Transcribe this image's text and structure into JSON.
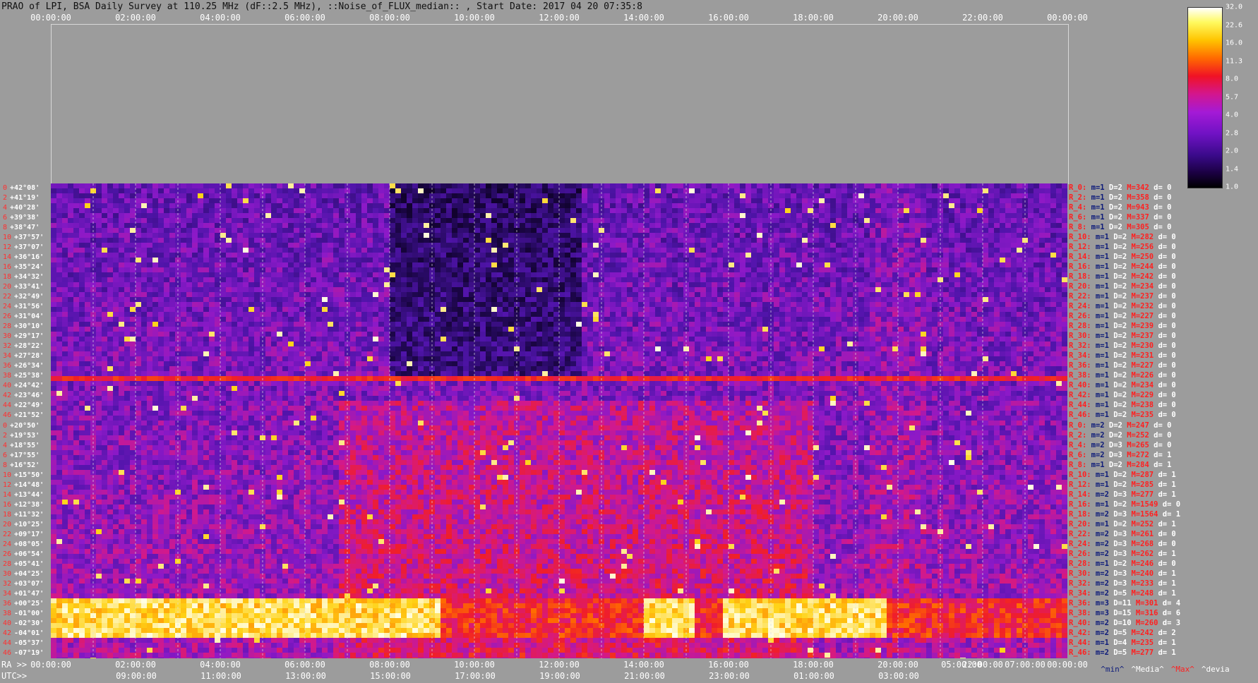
{
  "title": "PRAO of LPI, BSA Daily Survey at 110.25 MHz (dF::2.5 MHz), ::Noise_of_FLUX_median:: , Start Date: 2017 04 20 07:35:8",
  "chart_data": {
    "type": "heatmap",
    "x_ticks_top": [
      "00:00:00",
      "02:00:00",
      "04:00:00",
      "06:00:00",
      "08:00:00",
      "10:00:00",
      "12:00:00",
      "14:00:00",
      "16:00:00",
      "18:00:00",
      "20:00:00",
      "22:00:00",
      "00:00:00"
    ],
    "x_ticks_ra": [
      "00:00:00",
      "02:00:00",
      "04:00:00",
      "06:00:00",
      "08:00:00",
      "10:00:00",
      "12:00:00",
      "14:00:00",
      "16:00:00",
      "18:00:00",
      "20:00:00",
      "05:00:00",
      "22:00:00",
      "07:00:00",
      "00:00:00"
    ],
    "x_ticks_utc": [
      "09:00:00",
      "11:00:00",
      "13:00:00",
      "15:00:00",
      "17:00:00",
      "19:00:00",
      "21:00:00",
      "23:00:00",
      "01:00:00",
      "03:00:00"
    ],
    "ra_prefix": "RA >>",
    "utc_prefix": "UTC>>",
    "colorbar_ticks": [
      "32.0",
      "22.6",
      "16.0",
      "11.3",
      "8.0",
      "5.7",
      "4.0",
      "2.8",
      "2.0",
      "1.4",
      "1.0"
    ],
    "declinations": [
      "+42°08'",
      "+41°19'",
      "+40°28'",
      "+39°38'",
      "+38°47'",
      "+37°57'",
      "+37°07'",
      "+36°16'",
      "+35°24'",
      "+34°32'",
      "+33°41'",
      "+32°49'",
      "+31°56'",
      "+31°04'",
      "+30°10'",
      "+29°17'",
      "+28°22'",
      "+27°28'",
      "+26°34'",
      "+25°38'",
      "+24°42'",
      "+23°46'",
      "+22°49'",
      "+21°52'",
      "+20°50'",
      "+19°53'",
      "+18°55'",
      "+17°55'",
      "+16°52'",
      "+15°50'",
      "+14°48'",
      "+13°44'",
      "+12°38'",
      "+11°32'",
      "+10°25'",
      "+09°17'",
      "+08°05'",
      "+06°54'",
      "+05°41'",
      "+04°25'",
      "+03°07'",
      "+01°47'",
      "+00°25'",
      "-01°00'",
      "-02°30'",
      "-04°01'",
      "-05°37'",
      "-07°19'"
    ],
    "dec_indices": [
      "0",
      "2",
      "4",
      "6",
      "8",
      "10",
      "12",
      "14",
      "16",
      "18",
      "20",
      "22",
      "24",
      "26",
      "28",
      "30",
      "32",
      "34",
      "36",
      "38",
      "40",
      "42",
      "44",
      "46",
      "0",
      "2",
      "4",
      "6",
      "8",
      "10",
      "12",
      "14",
      "16",
      "18",
      "20",
      "22",
      "24",
      "26",
      "28",
      "30",
      "32",
      "34",
      "36",
      "38",
      "40",
      "42",
      "44",
      "46"
    ],
    "row_stats": [
      {
        "r": "R_0:",
        "m": "m=1",
        "D": "D=2",
        "M": "M=342",
        "d": "d= 0"
      },
      {
        "r": "R_2:",
        "m": "m=1",
        "D": "D=2",
        "M": "M=358",
        "d": "d= 0"
      },
      {
        "r": "R_4:",
        "m": "m=1",
        "D": "D=2",
        "M": "M=943",
        "d": "d= 0"
      },
      {
        "r": "R_6:",
        "m": "m=1",
        "D": "D=2",
        "M": "M=337",
        "d": "d= 0"
      },
      {
        "r": "R_8:",
        "m": "m=1",
        "D": "D=2",
        "M": "M=305",
        "d": "d= 0"
      },
      {
        "r": "R_10:",
        "m": "m=1",
        "D": "D=2",
        "M": "M=282",
        "d": "d= 0"
      },
      {
        "r": "R_12:",
        "m": "m=1",
        "D": "D=2",
        "M": "M=256",
        "d": "d= 0"
      },
      {
        "r": "R_14:",
        "m": "m=1",
        "D": "D=2",
        "M": "M=250",
        "d": "d= 0"
      },
      {
        "r": "R_16:",
        "m": "m=1",
        "D": "D=2",
        "M": "M=244",
        "d": "d= 0"
      },
      {
        "r": "R_18:",
        "m": "m=1",
        "D": "D=2",
        "M": "M=242",
        "d": "d= 0"
      },
      {
        "r": "R_20:",
        "m": "m=1",
        "D": "D=2",
        "M": "M=234",
        "d": "d= 0"
      },
      {
        "r": "R_22:",
        "m": "m=1",
        "D": "D=2",
        "M": "M=237",
        "d": "d= 0"
      },
      {
        "r": "R_24:",
        "m": "m=1",
        "D": "D=2",
        "M": "M=232",
        "d": "d= 0"
      },
      {
        "r": "R_26:",
        "m": "m=1",
        "D": "D=2",
        "M": "M=227",
        "d": "d= 0"
      },
      {
        "r": "R_28:",
        "m": "m=1",
        "D": "D=2",
        "M": "M=239",
        "d": "d= 0"
      },
      {
        "r": "R_30:",
        "m": "m=1",
        "D": "D=2",
        "M": "M=237",
        "d": "d= 0"
      },
      {
        "r": "R_32:",
        "m": "m=1",
        "D": "D=2",
        "M": "M=230",
        "d": "d= 0"
      },
      {
        "r": "R_34:",
        "m": "m=1",
        "D": "D=2",
        "M": "M=231",
        "d": "d= 0"
      },
      {
        "r": "R_36:",
        "m": "m=1",
        "D": "D=2",
        "M": "M=227",
        "d": "d= 0"
      },
      {
        "r": "R_38:",
        "m": "m=1",
        "D": "D=2",
        "M": "M=226",
        "d": "d= 0"
      },
      {
        "r": "R_40:",
        "m": "m=1",
        "D": "D=2",
        "M": "M=234",
        "d": "d= 0"
      },
      {
        "r": "R_42:",
        "m": "m=1",
        "D": "D=2",
        "M": "M=229",
        "d": "d= 0"
      },
      {
        "r": "R_44:",
        "m": "m=1",
        "D": "D=2",
        "M": "M=238",
        "d": "d= 0"
      },
      {
        "r": "R_46:",
        "m": "m=1",
        "D": "D=2",
        "M": "M=235",
        "d": "d= 0"
      },
      {
        "r": "R_0:",
        "m": "m=2",
        "D": "D=2",
        "M": "M=247",
        "d": "d= 0"
      },
      {
        "r": "R_2:",
        "m": "m=2",
        "D": "D=2",
        "M": "M=252",
        "d": "d= 0"
      },
      {
        "r": "R_4:",
        "m": "m=2",
        "D": "D=3",
        "M": "M=265",
        "d": "d= 0"
      },
      {
        "r": "R_6:",
        "m": "m=2",
        "D": "D=3",
        "M": "M=272",
        "d": "d= 1"
      },
      {
        "r": "R_8:",
        "m": "m=1",
        "D": "D=2",
        "M": "M=284",
        "d": "d= 1"
      },
      {
        "r": "R_10:",
        "m": "m=1",
        "D": "D=2",
        "M": "M=287",
        "d": "d= 1"
      },
      {
        "r": "R_12:",
        "m": "m=1",
        "D": "D=2",
        "M": "M=285",
        "d": "d= 1"
      },
      {
        "r": "R_14:",
        "m": "m=2",
        "D": "D=3",
        "M": "M=277",
        "d": "d= 1"
      },
      {
        "r": "R_16:",
        "m": "m=1",
        "D": "D=2",
        "M": "M=1549",
        "d": "d= 0"
      },
      {
        "r": "R_18:",
        "m": "m=2",
        "D": "D=3",
        "M": "M=1564",
        "d": "d= 1"
      },
      {
        "r": "R_20:",
        "m": "m=1",
        "D": "D=2",
        "M": "M=252",
        "d": "d= 1"
      },
      {
        "r": "R_22:",
        "m": "m=2",
        "D": "D=3",
        "M": "M=261",
        "d": "d= 0"
      },
      {
        "r": "R_24:",
        "m": "m=2",
        "D": "D=3",
        "M": "M=268",
        "d": "d= 0"
      },
      {
        "r": "R_26:",
        "m": "m=2",
        "D": "D=3",
        "M": "M=262",
        "d": "d= 1"
      },
      {
        "r": "R_28:",
        "m": "m=1",
        "D": "D=2",
        "M": "M=246",
        "d": "d= 0"
      },
      {
        "r": "R_30:",
        "m": "m=2",
        "D": "D=3",
        "M": "M=240",
        "d": "d= 1"
      },
      {
        "r": "R_32:",
        "m": "m=2",
        "D": "D=3",
        "M": "M=233",
        "d": "d= 1"
      },
      {
        "r": "R_34:",
        "m": "m=2",
        "D": "D=5",
        "M": "M=248",
        "d": "d= 1"
      },
      {
        "r": "R_36:",
        "m": "m=3",
        "D": "D=11",
        "M": "M=301",
        "d": "d= 4"
      },
      {
        "r": "R_38:",
        "m": "m=3",
        "D": "D=15",
        "M": "M=316",
        "d": "d= 6"
      },
      {
        "r": "R_40:",
        "m": "m=2",
        "D": "D=10",
        "M": "M=260",
        "d": "d= 3"
      },
      {
        "r": "R_42:",
        "m": "m=2",
        "D": "D=5",
        "M": "M=242",
        "d": "d= 2"
      },
      {
        "r": "R_44:",
        "m": "m=1",
        "D": "D=4",
        "M": "M=235",
        "d": "d= 1"
      },
      {
        "r": "R_46:",
        "m": "m=2",
        "D": "D=5",
        "M": "M=277",
        "d": "d= 1"
      }
    ],
    "legend_keys": {
      "min": "^min^",
      "media": "^Media^",
      "max": "^Max^",
      "devia": "^devia"
    }
  }
}
